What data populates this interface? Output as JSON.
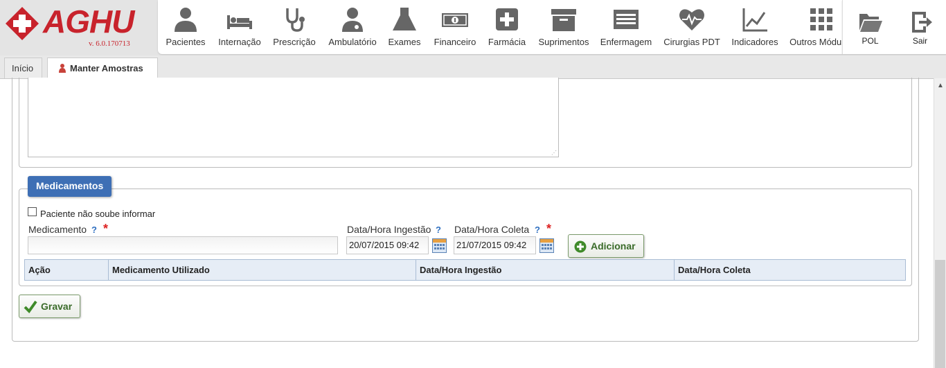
{
  "app": {
    "logo_text": "AGHU",
    "version": "v. 6.0.170713"
  },
  "menu": [
    {
      "label": "Pacientes",
      "icon": "person-icon"
    },
    {
      "label": "Internação",
      "icon": "bed-icon"
    },
    {
      "label": "Prescrição",
      "icon": "stethoscope-icon"
    },
    {
      "label": "Ambulatório",
      "icon": "doctor-icon"
    },
    {
      "label": "Exames",
      "icon": "flask-icon"
    },
    {
      "label": "Financeiro",
      "icon": "money-icon"
    },
    {
      "label": "Farmácia",
      "icon": "plus-cross-icon"
    },
    {
      "label": "Suprimentos",
      "icon": "archive-box-icon"
    },
    {
      "label": "Enfermagem",
      "icon": "list-board-icon"
    },
    {
      "label": "Cirurgias PDT",
      "icon": "heart-pulse-icon"
    },
    {
      "label": "Indicadores",
      "icon": "line-chart-icon"
    },
    {
      "label": "Outros Módulos",
      "icon": "grid-icon"
    }
  ],
  "right_menu": [
    {
      "label": "POL",
      "icon": "folder-icon"
    },
    {
      "label": "Sair",
      "icon": "exit-icon"
    }
  ],
  "tabs": [
    {
      "label": "Início"
    },
    {
      "label": "Manter Amostras",
      "close": "×"
    }
  ],
  "medicamentos": {
    "legend": "Medicamentos",
    "checkbox_label": "Paciente não soube informar",
    "checkbox_checked": false,
    "medicamento_label": "Medicamento",
    "medicamento_value": "",
    "ingestao_label": "Data/Hora Ingestão",
    "ingestao_value": "20/07/2015 09:42",
    "coleta_label": "Data/Hora Coleta",
    "coleta_value": "21/07/2015 09:42",
    "help_mark": "?",
    "required_mark": "*",
    "add_button": "Adicionar",
    "table_headers": [
      "Ação",
      "Medicamento Utilizado",
      "Data/Hora Ingestão",
      "Data/Hora Coleta"
    ]
  },
  "save_button": "Gravar",
  "colors": {
    "brand_red": "#c8232c",
    "legend_blue": "#3e6fb5",
    "button_green": "#3a6b2a",
    "help_blue": "#2f6fc0"
  }
}
